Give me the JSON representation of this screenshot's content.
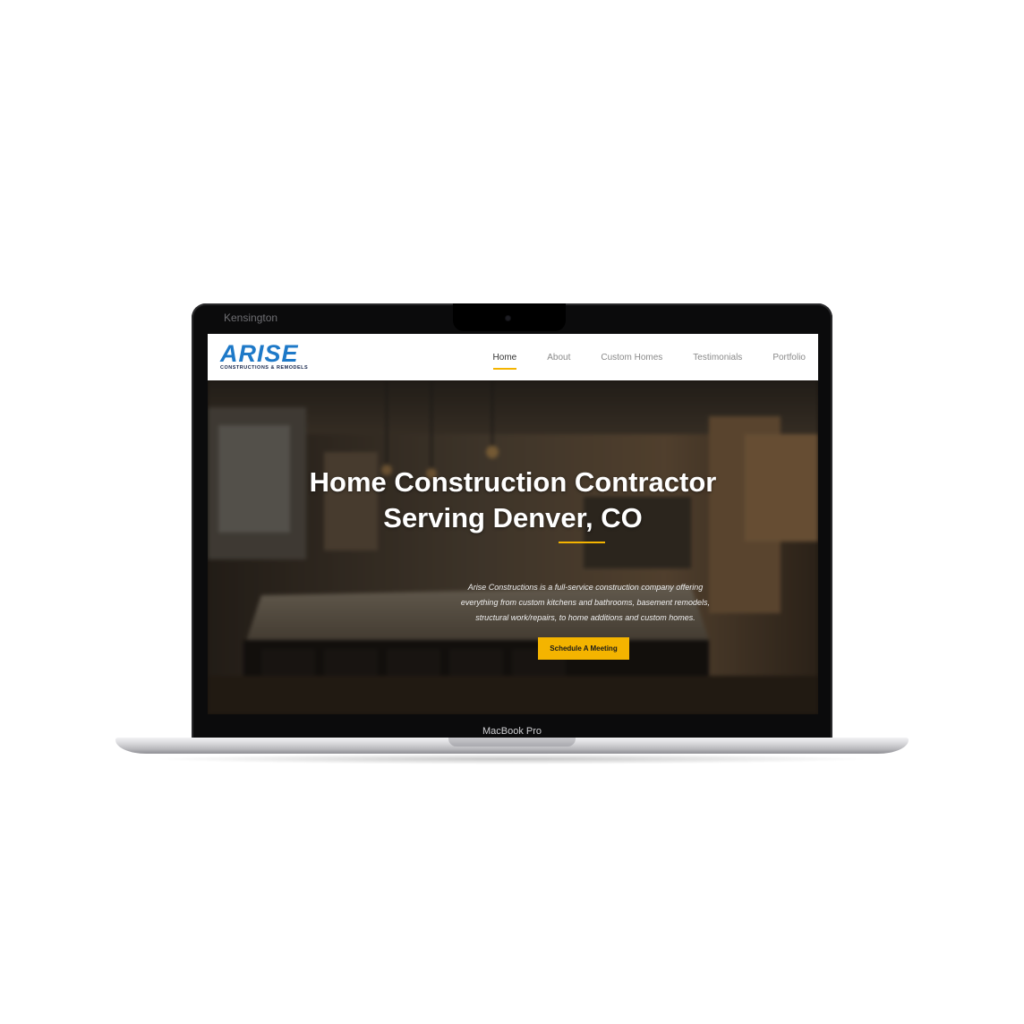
{
  "laptop": {
    "lid_brand": "Kensington",
    "model_label": "MacBook Pro"
  },
  "site": {
    "logo": {
      "wordmark": "ARISE",
      "tagline": "CONSTRUCTIONS & REMODELS",
      "color": "#1e79c8"
    },
    "nav": {
      "items": [
        {
          "label": "Home",
          "active": true
        },
        {
          "label": "About",
          "active": false
        },
        {
          "label": "Custom Homes",
          "active": false
        },
        {
          "label": "Testimonials",
          "active": false
        },
        {
          "label": "Portfolio",
          "active": false
        }
      ],
      "accent": "#f4b400"
    },
    "hero": {
      "title_line1": "Home Construction Contractor",
      "title_line2": "Serving Denver, CO",
      "copy_line1": "Arise Constructions is a full-service construction company offering",
      "copy_line2": "everything from custom kitchens and bathrooms, basement remodels,",
      "copy_line3": "structural work/repairs, to home additions and custom homes.",
      "cta_label": "Schedule A Meeting",
      "cta_color": "#f4b400"
    }
  }
}
